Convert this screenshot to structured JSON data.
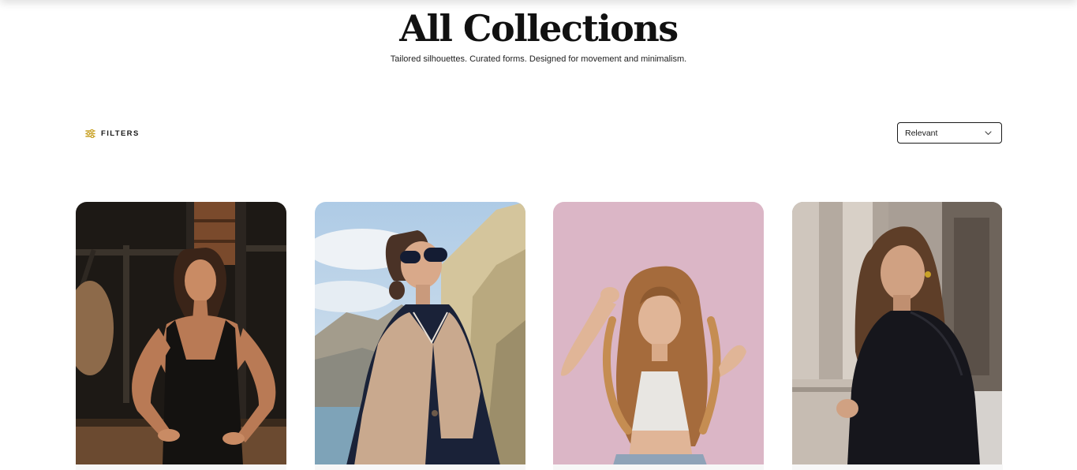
{
  "header": {
    "title": "All Collections",
    "subtitle": "Tailored silhouettes. Curated forms. Designed for movement and minimalism."
  },
  "toolbar": {
    "filters_label": "FILTERS",
    "filters_icon": "sliders-icon",
    "filters_icon_color": "#c9a227",
    "sort_value": "Relevant",
    "sort_icon": "chevron-down-icon"
  },
  "products": [
    {
      "image": "model-dark-dress-photo"
    },
    {
      "image": "model-cape-sunglasses-photo"
    },
    {
      "image": "model-curly-hair-pink-photo"
    },
    {
      "image": "model-black-coat-columns-photo"
    }
  ]
}
